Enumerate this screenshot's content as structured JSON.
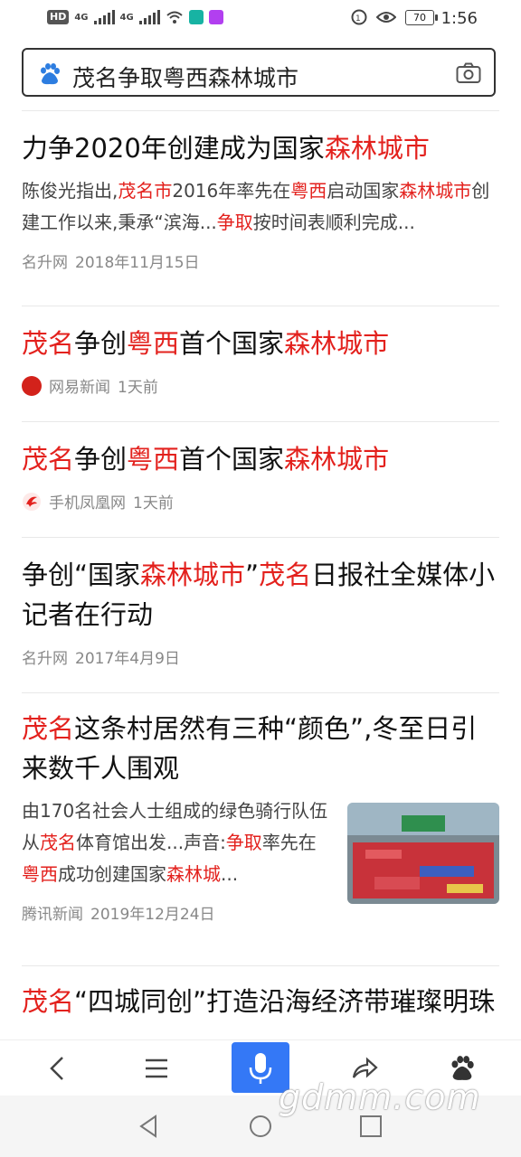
{
  "status": {
    "hd": "HD",
    "net1": "4G",
    "net2": "4G",
    "battery": "70",
    "time": "1:56"
  },
  "search": {
    "query": "茂名争取粤西森林城市"
  },
  "results": [
    {
      "title": [
        "力争2020年创建成为国家",
        "森林城市"
      ],
      "abstract": [
        {
          "t": "陈俊光指出,",
          "r": false
        },
        {
          "t": "茂名市",
          "r": true
        },
        {
          "t": "2016年率先在",
          "r": false
        },
        {
          "t": "粤西",
          "r": true
        },
        {
          "t": "启动国家",
          "r": false
        },
        {
          "t": "森林城市",
          "r": true
        },
        {
          "t": "创建工作以来,秉承“滨海...",
          "r": false
        },
        {
          "t": "争取",
          "r": true
        },
        {
          "t": "按时间表顺利完成...",
          "r": false
        }
      ],
      "source": "名升网",
      "date": "2018年11月15日"
    },
    {
      "title_parts": [
        {
          "t": "茂名",
          "r": true
        },
        {
          "t": "争创",
          "r": false
        },
        {
          "t": "粤西",
          "r": true
        },
        {
          "t": "首个国家",
          "r": false
        },
        {
          "t": "森林城市",
          "r": true
        }
      ],
      "source": "网易新闻",
      "date": "1天前"
    },
    {
      "title_parts": [
        {
          "t": "茂名",
          "r": true
        },
        {
          "t": "争创",
          "r": false
        },
        {
          "t": "粤西",
          "r": true
        },
        {
          "t": "首个国家",
          "r": false
        },
        {
          "t": "森林城市",
          "r": true
        }
      ],
      "source": "手机凤凰网",
      "date": "1天前"
    },
    {
      "title_parts": [
        {
          "t": "争创“国家",
          "r": false
        },
        {
          "t": "森林城市",
          "r": true
        },
        {
          "t": "”",
          "r": false
        },
        {
          "t": "茂名",
          "r": true
        },
        {
          "t": "日报社全媒体小记者在行动",
          "r": false
        }
      ],
      "source": "名升网",
      "date": "2017年4月9日"
    },
    {
      "title_parts": [
        {
          "t": "茂名",
          "r": true
        },
        {
          "t": "这条村居然有三种“颜色”,冬至日引来数千人围观",
          "r": false
        }
      ],
      "abstract": [
        {
          "t": "由170名社会人士组成的绿色骑行队伍从",
          "r": false
        },
        {
          "t": "茂名",
          "r": true
        },
        {
          "t": "体育馆出发...声音:",
          "r": false
        },
        {
          "t": "争取",
          "r": true
        },
        {
          "t": "率先在",
          "r": false
        },
        {
          "t": "粤西",
          "r": true
        },
        {
          "t": "成功创建国家",
          "r": false
        },
        {
          "t": "森林城",
          "r": true
        },
        {
          "t": "...",
          "r": false
        }
      ],
      "source": "腾讯新闻",
      "date": "2019年12月24日"
    },
    {
      "title_parts": [
        {
          "t": "茂名",
          "r": true
        },
        {
          "t": "“四城同创”打造沿海经济带璀璨明珠",
          "r": false
        }
      ]
    }
  ],
  "watermark": "gdmm.com",
  "colors": {
    "highlight": "#e3211d",
    "accent": "#3478f6"
  },
  "icons": [
    "baidu-paw-icon",
    "camera-icon",
    "back-icon",
    "menu-icon",
    "mic-icon",
    "share-icon",
    "baidu-home-icon"
  ]
}
